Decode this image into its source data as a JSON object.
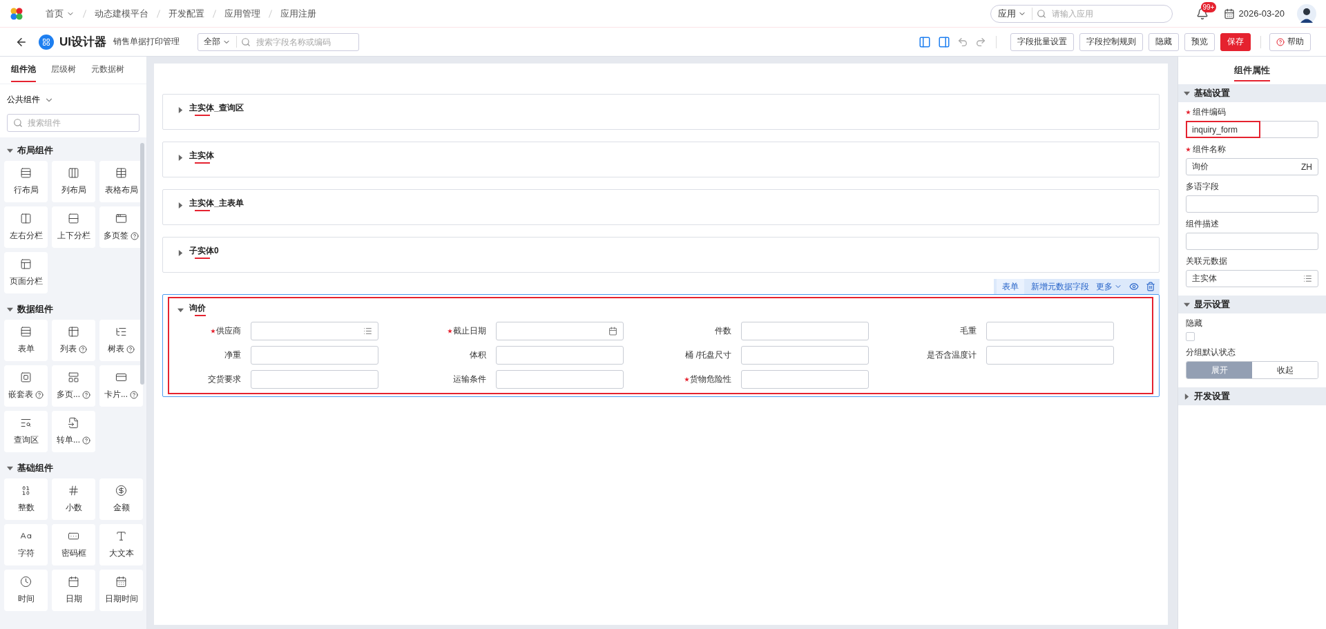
{
  "top_bar": {
    "breadcrumb": [
      {
        "label": "首页",
        "dropdown": true
      },
      {
        "label": "动态建模平台",
        "dropdown": false
      },
      {
        "label": "开发配置",
        "dropdown": false
      },
      {
        "label": "应用管理",
        "dropdown": false
      },
      {
        "label": "应用注册",
        "dropdown": false
      }
    ],
    "app_search": {
      "scope": "应用",
      "placeholder": "请输入应用"
    },
    "notification_badge": "99+",
    "date": "2026-03-20"
  },
  "designer_bar": {
    "title": "UI设计器",
    "subtitle": "销售单据打印管理",
    "field_search": {
      "scope": "全部",
      "placeholder": "搜索字段名称或编码"
    },
    "buttons": [
      {
        "label": "字段批量设置",
        "kind": "default"
      },
      {
        "label": "字段控制规则",
        "kind": "default"
      },
      {
        "label": "隐藏",
        "kind": "default"
      },
      {
        "label": "预览",
        "kind": "default"
      },
      {
        "label": "保存",
        "kind": "primary"
      }
    ],
    "help": "帮助"
  },
  "left_panel": {
    "tabs": [
      {
        "label": "组件池",
        "selected": true
      },
      {
        "label": "层级树",
        "selected": false
      },
      {
        "label": "元数据树",
        "selected": false
      }
    ],
    "library": "公共组件",
    "search": {
      "placeholder": "搜索组件"
    },
    "groups": [
      {
        "title": "布局组件",
        "expanded": true,
        "items": [
          {
            "label": "行布局",
            "help": false
          },
          {
            "label": "列布局",
            "help": false
          },
          {
            "label": "表格布局",
            "help": false
          },
          {
            "label": "左右分栏",
            "help": false
          },
          {
            "label": "上下分栏",
            "help": false
          },
          {
            "label": "多页签",
            "help": true
          },
          {
            "label": "页面分栏",
            "help": false
          }
        ]
      },
      {
        "title": "数据组件",
        "expanded": true,
        "items": [
          {
            "label": "表单",
            "help": false
          },
          {
            "label": "列表",
            "help": true
          },
          {
            "label": "树表",
            "help": true
          },
          {
            "label": "嵌套表",
            "help": true
          },
          {
            "label": "多页...",
            "help": true
          },
          {
            "label": "卡片...",
            "help": true
          },
          {
            "label": "查询区",
            "help": false
          },
          {
            "label": "转单...",
            "help": true
          }
        ]
      },
      {
        "title": "基础组件",
        "expanded": true,
        "items": [
          {
            "label": "整数",
            "help": false
          },
          {
            "label": "小数",
            "help": false
          },
          {
            "label": "金额",
            "help": false
          },
          {
            "label": "字符",
            "help": false
          },
          {
            "label": "密码框",
            "help": false
          },
          {
            "label": "大文本",
            "help": false
          },
          {
            "label": "时间",
            "help": false
          },
          {
            "label": "日期",
            "help": false
          },
          {
            "label": "日期时间",
            "help": false
          }
        ]
      }
    ]
  },
  "canvas": {
    "sections": [
      {
        "title": "主实体_查询区",
        "expanded": false,
        "selected": false
      },
      {
        "title": "主实体",
        "expanded": false,
        "selected": false
      },
      {
        "title": "主实体_主表单",
        "expanded": false,
        "selected": false
      },
      {
        "title": "子实体0",
        "expanded": false,
        "selected": false
      },
      {
        "title": "询价",
        "expanded": true,
        "selected": true,
        "highlighted": true,
        "toolbar": {
          "tag": "表单",
          "add": "新增元数据字段",
          "more": "更多"
        },
        "fields": [
          {
            "label": "供应商",
            "required": true,
            "kind": "picker"
          },
          {
            "label": "截止日期",
            "required": true,
            "kind": "date"
          },
          {
            "label": "件数",
            "required": false,
            "kind": "text"
          },
          {
            "label": "毛重",
            "required": false,
            "kind": "text"
          },
          {
            "label": "净重",
            "required": false,
            "kind": "text"
          },
          {
            "label": "体积",
            "required": false,
            "kind": "text"
          },
          {
            "label": "桶 /托盘尺寸",
            "required": false,
            "kind": "text"
          },
          {
            "label": "是否含温度计",
            "required": false,
            "kind": "text"
          },
          {
            "label": "交货要求",
            "required": false,
            "kind": "text"
          },
          {
            "label": "运输条件",
            "required": false,
            "kind": "text"
          },
          {
            "label": "货物危险性",
            "required": true,
            "kind": "text"
          }
        ]
      }
    ]
  },
  "properties": {
    "title": "组件属性",
    "groups": [
      {
        "title": "基础设置",
        "expanded": true,
        "items": [
          {
            "kind": "input",
            "label": "组件编码",
            "required": true,
            "value": "inquiry_form",
            "highlighted": true
          },
          {
            "kind": "input",
            "label": "组件名称",
            "required": true,
            "value": "询价",
            "suffix": "ZH",
            "highlighted": false
          },
          {
            "kind": "input",
            "label": "多语字段",
            "required": false,
            "highlighted": false
          },
          {
            "kind": "input",
            "label": "组件描述",
            "required": false,
            "highlighted": false
          },
          {
            "kind": "picker",
            "label": "关联元数据",
            "required": false,
            "value": "主实体",
            "highlighted": false
          }
        ]
      },
      {
        "title": "显示设置",
        "expanded": true,
        "items": [
          {
            "kind": "checkbox",
            "label": "隐藏",
            "checked": false
          },
          {
            "kind": "segmented",
            "label": "分组默认状态",
            "options": [
              {
                "label": "展开",
                "selected": true
              },
              {
                "label": "收起",
                "selected": false
              }
            ]
          }
        ]
      },
      {
        "title": "开发设置",
        "expanded": false
      }
    ]
  }
}
